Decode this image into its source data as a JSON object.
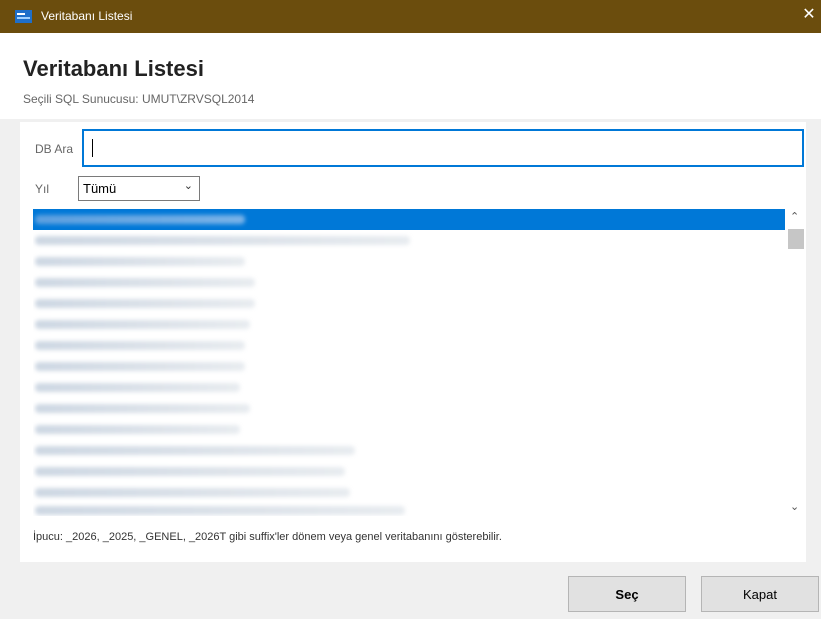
{
  "window": {
    "title": "Veritabanı Listesi",
    "close_glyph": "✕"
  },
  "header": {
    "heading": "Veritabanı Listesi",
    "server_info": "Seçili SQL Sunucusu: UMUT\\ZRVSQL2014"
  },
  "search": {
    "label": "DB Ara",
    "value": ""
  },
  "year_filter": {
    "label": "Yıl",
    "selected": "Tümü"
  },
  "database_list": {
    "selected_index": 0
  },
  "hint": "İpucu: _2026, _2025, _GENEL, _2026T gibi suffix'ler dönem veya genel veritabanını gösterebilir.",
  "buttons": {
    "select_label": "Seç",
    "close_label": "Kapat"
  },
  "colors": {
    "titlebar": "#6b4d0d",
    "accent": "#0078d7"
  }
}
